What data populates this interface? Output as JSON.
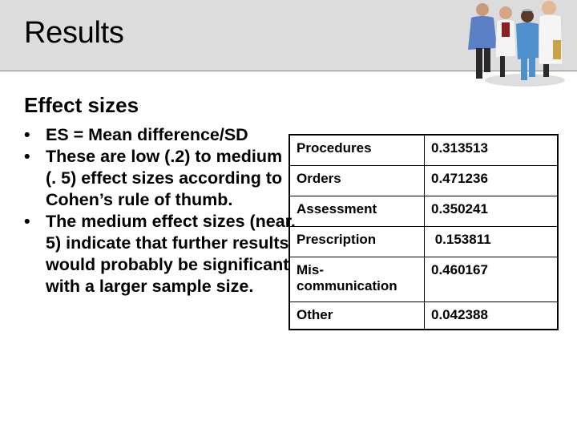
{
  "slide": {
    "title": "Results",
    "subtitle": "Effect sizes",
    "bullets": [
      "ES = Mean difference/SD",
      "These are low (.2) to medium (. 5) effect sizes according to Cohen’s rule of thumb.",
      "The medium effect sizes (near. 5) indicate that further results would probably be significant with a larger sample size."
    ],
    "bullet_glyph": "•",
    "image": {
      "icon": "medical-staff-photo",
      "description": "Group of four healthcare workers"
    }
  },
  "table": {
    "rows": [
      {
        "category": "Procedures",
        "value": "0.313513"
      },
      {
        "category": "Orders",
        "value": "0.471236"
      },
      {
        "category": "Assessment",
        "value": "0.350241"
      },
      {
        "category": "Prescription",
        "value": " 0.153811"
      },
      {
        "category": "Mis-communication",
        "value": "0.460167"
      },
      {
        "category": "Other",
        "value": "0.042388"
      }
    ]
  },
  "colors": {
    "header_bg": "#dcdcdc",
    "header_rule": "#7d8590",
    "text": "#000000"
  }
}
